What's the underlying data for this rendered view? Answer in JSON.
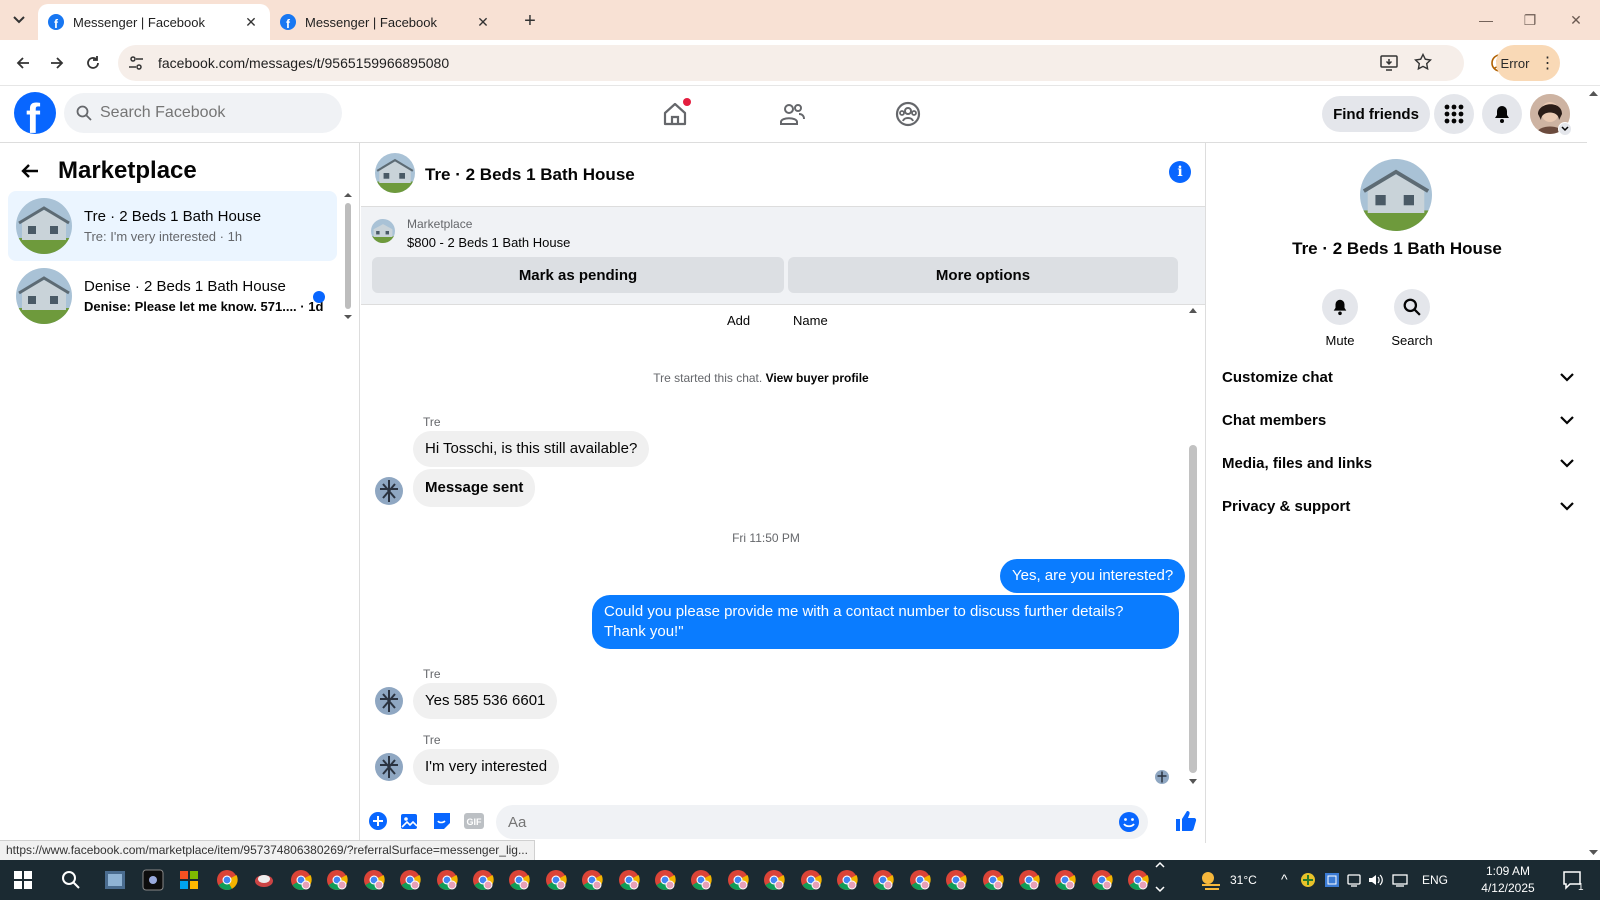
{
  "browser": {
    "tabs": [
      {
        "title": "Messenger | Facebook"
      },
      {
        "title": "Messenger | Facebook"
      }
    ],
    "url": "facebook.com/messages/t/9565159966895080",
    "profile_status": "Error",
    "status_url": "https://www.facebook.com/marketplace/item/957374806380269/?referralSurface=messenger_lig..."
  },
  "fb": {
    "logo": "f",
    "search_placeholder": "Search Facebook",
    "find_friends": "Find friends"
  },
  "left": {
    "title": "Marketplace",
    "conversations": [
      {
        "name": "Tre · 2 Beds 1 Bath House",
        "snippet": "Tre: I'm very interested · 1h",
        "active": true,
        "unread": false
      },
      {
        "name": "Denise · 2 Beds 1 Bath House",
        "snippet": "Denise: Please let me know. 571.... · 1d",
        "active": false,
        "unread": true
      }
    ]
  },
  "chat": {
    "title": "Tre · 2 Beds 1 Bath House",
    "listing": {
      "source": "Marketplace",
      "price_title": "$800 - 2 Beds 1 Bath House",
      "btn_pending": "Mark as pending",
      "btn_more": "More options"
    },
    "top_labels": {
      "add": "Add",
      "name": "Name"
    },
    "system": {
      "text": "Tre started this chat.",
      "link": "View buyer profile"
    },
    "messages": {
      "m1_sender": "Tre",
      "m1": "Hi Tosschi, is this still available?",
      "m2": "Message sent",
      "timestamp": "Fri 11:50 PM",
      "m3": "Yes, are you interested?",
      "m4": "Could you please provide me with a contact number to discuss further details? Thank you!\"",
      "m5_sender": "Tre",
      "m5": "Yes 585 536 6601",
      "m6_sender": "Tre",
      "m6": "I'm very interested"
    },
    "composer_placeholder": "Aa"
  },
  "right": {
    "name": "Tre · 2 Beds 1 Bath House",
    "actions": {
      "mute": "Mute",
      "search": "Search"
    },
    "sections": [
      "Customize chat",
      "Chat members",
      "Media, files and links",
      "Privacy & support"
    ]
  },
  "taskbar": {
    "weather": "31°C",
    "lang": "ENG",
    "time": "1:09 AM",
    "date": "4/12/2025",
    "notif_count": "1"
  },
  "colors": {
    "fb_blue": "#0866ff",
    "out_bubble": "#0a7cff",
    "tabbar": "#f8e1d4",
    "taskbar": "#1b2a32"
  }
}
